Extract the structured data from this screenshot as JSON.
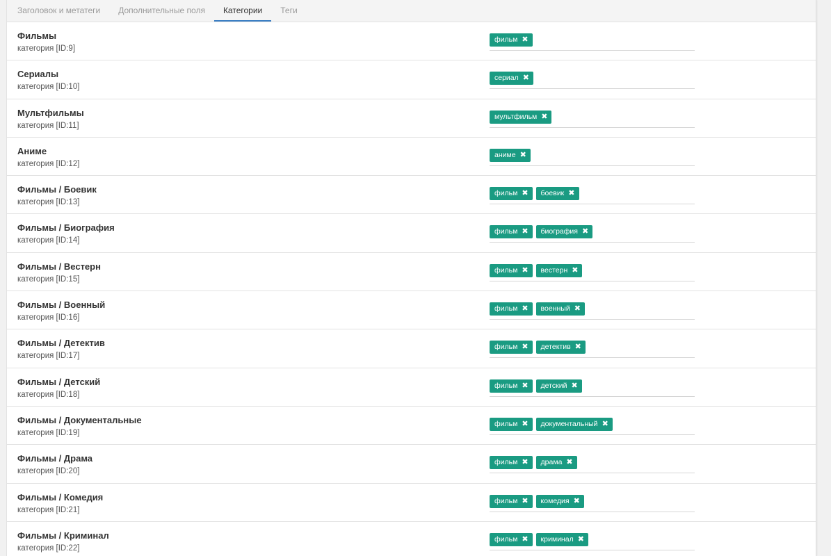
{
  "tabs": [
    {
      "label": "Заголовок и метатеги"
    },
    {
      "label": "Дополнительные поля"
    },
    {
      "label": "Категории"
    },
    {
      "label": "Теги"
    }
  ],
  "remove_glyph": "✖",
  "categories": [
    {
      "title": "Фильмы",
      "subtitle": "категория [ID:9]",
      "tags": [
        "фильм"
      ]
    },
    {
      "title": "Сериалы",
      "subtitle": "категория [ID:10]",
      "tags": [
        "сериал"
      ]
    },
    {
      "title": "Мультфильмы",
      "subtitle": "категория [ID:11]",
      "tags": [
        "мультфильм"
      ]
    },
    {
      "title": "Аниме",
      "subtitle": "категория [ID:12]",
      "tags": [
        "аниме"
      ]
    },
    {
      "title": "Фильмы / Боевик",
      "subtitle": "категория [ID:13]",
      "tags": [
        "фильм",
        "боевик"
      ]
    },
    {
      "title": "Фильмы / Биография",
      "subtitle": "категория [ID:14]",
      "tags": [
        "фильм",
        "биография"
      ]
    },
    {
      "title": "Фильмы / Вестерн",
      "subtitle": "категория [ID:15]",
      "tags": [
        "фильм",
        "вестерн"
      ]
    },
    {
      "title": "Фильмы / Военный",
      "subtitle": "категория [ID:16]",
      "tags": [
        "фильм",
        "военный"
      ]
    },
    {
      "title": "Фильмы / Детектив",
      "subtitle": "категория [ID:17]",
      "tags": [
        "фильм",
        "детектив"
      ]
    },
    {
      "title": "Фильмы / Детский",
      "subtitle": "категория [ID:18]",
      "tags": [
        "фильм",
        "детский"
      ]
    },
    {
      "title": "Фильмы / Документальные",
      "subtitle": "категория [ID:19]",
      "tags": [
        "фильм",
        "документальный"
      ]
    },
    {
      "title": "Фильмы / Драма",
      "subtitle": "категория [ID:20]",
      "tags": [
        "фильм",
        "драма"
      ]
    },
    {
      "title": "Фильмы / Комедия",
      "subtitle": "категория [ID:21]",
      "tags": [
        "фильм",
        "комедия"
      ]
    },
    {
      "title": "Фильмы / Криминал",
      "subtitle": "категория [ID:22]",
      "tags": [
        "фильм",
        "криминал"
      ]
    }
  ]
}
